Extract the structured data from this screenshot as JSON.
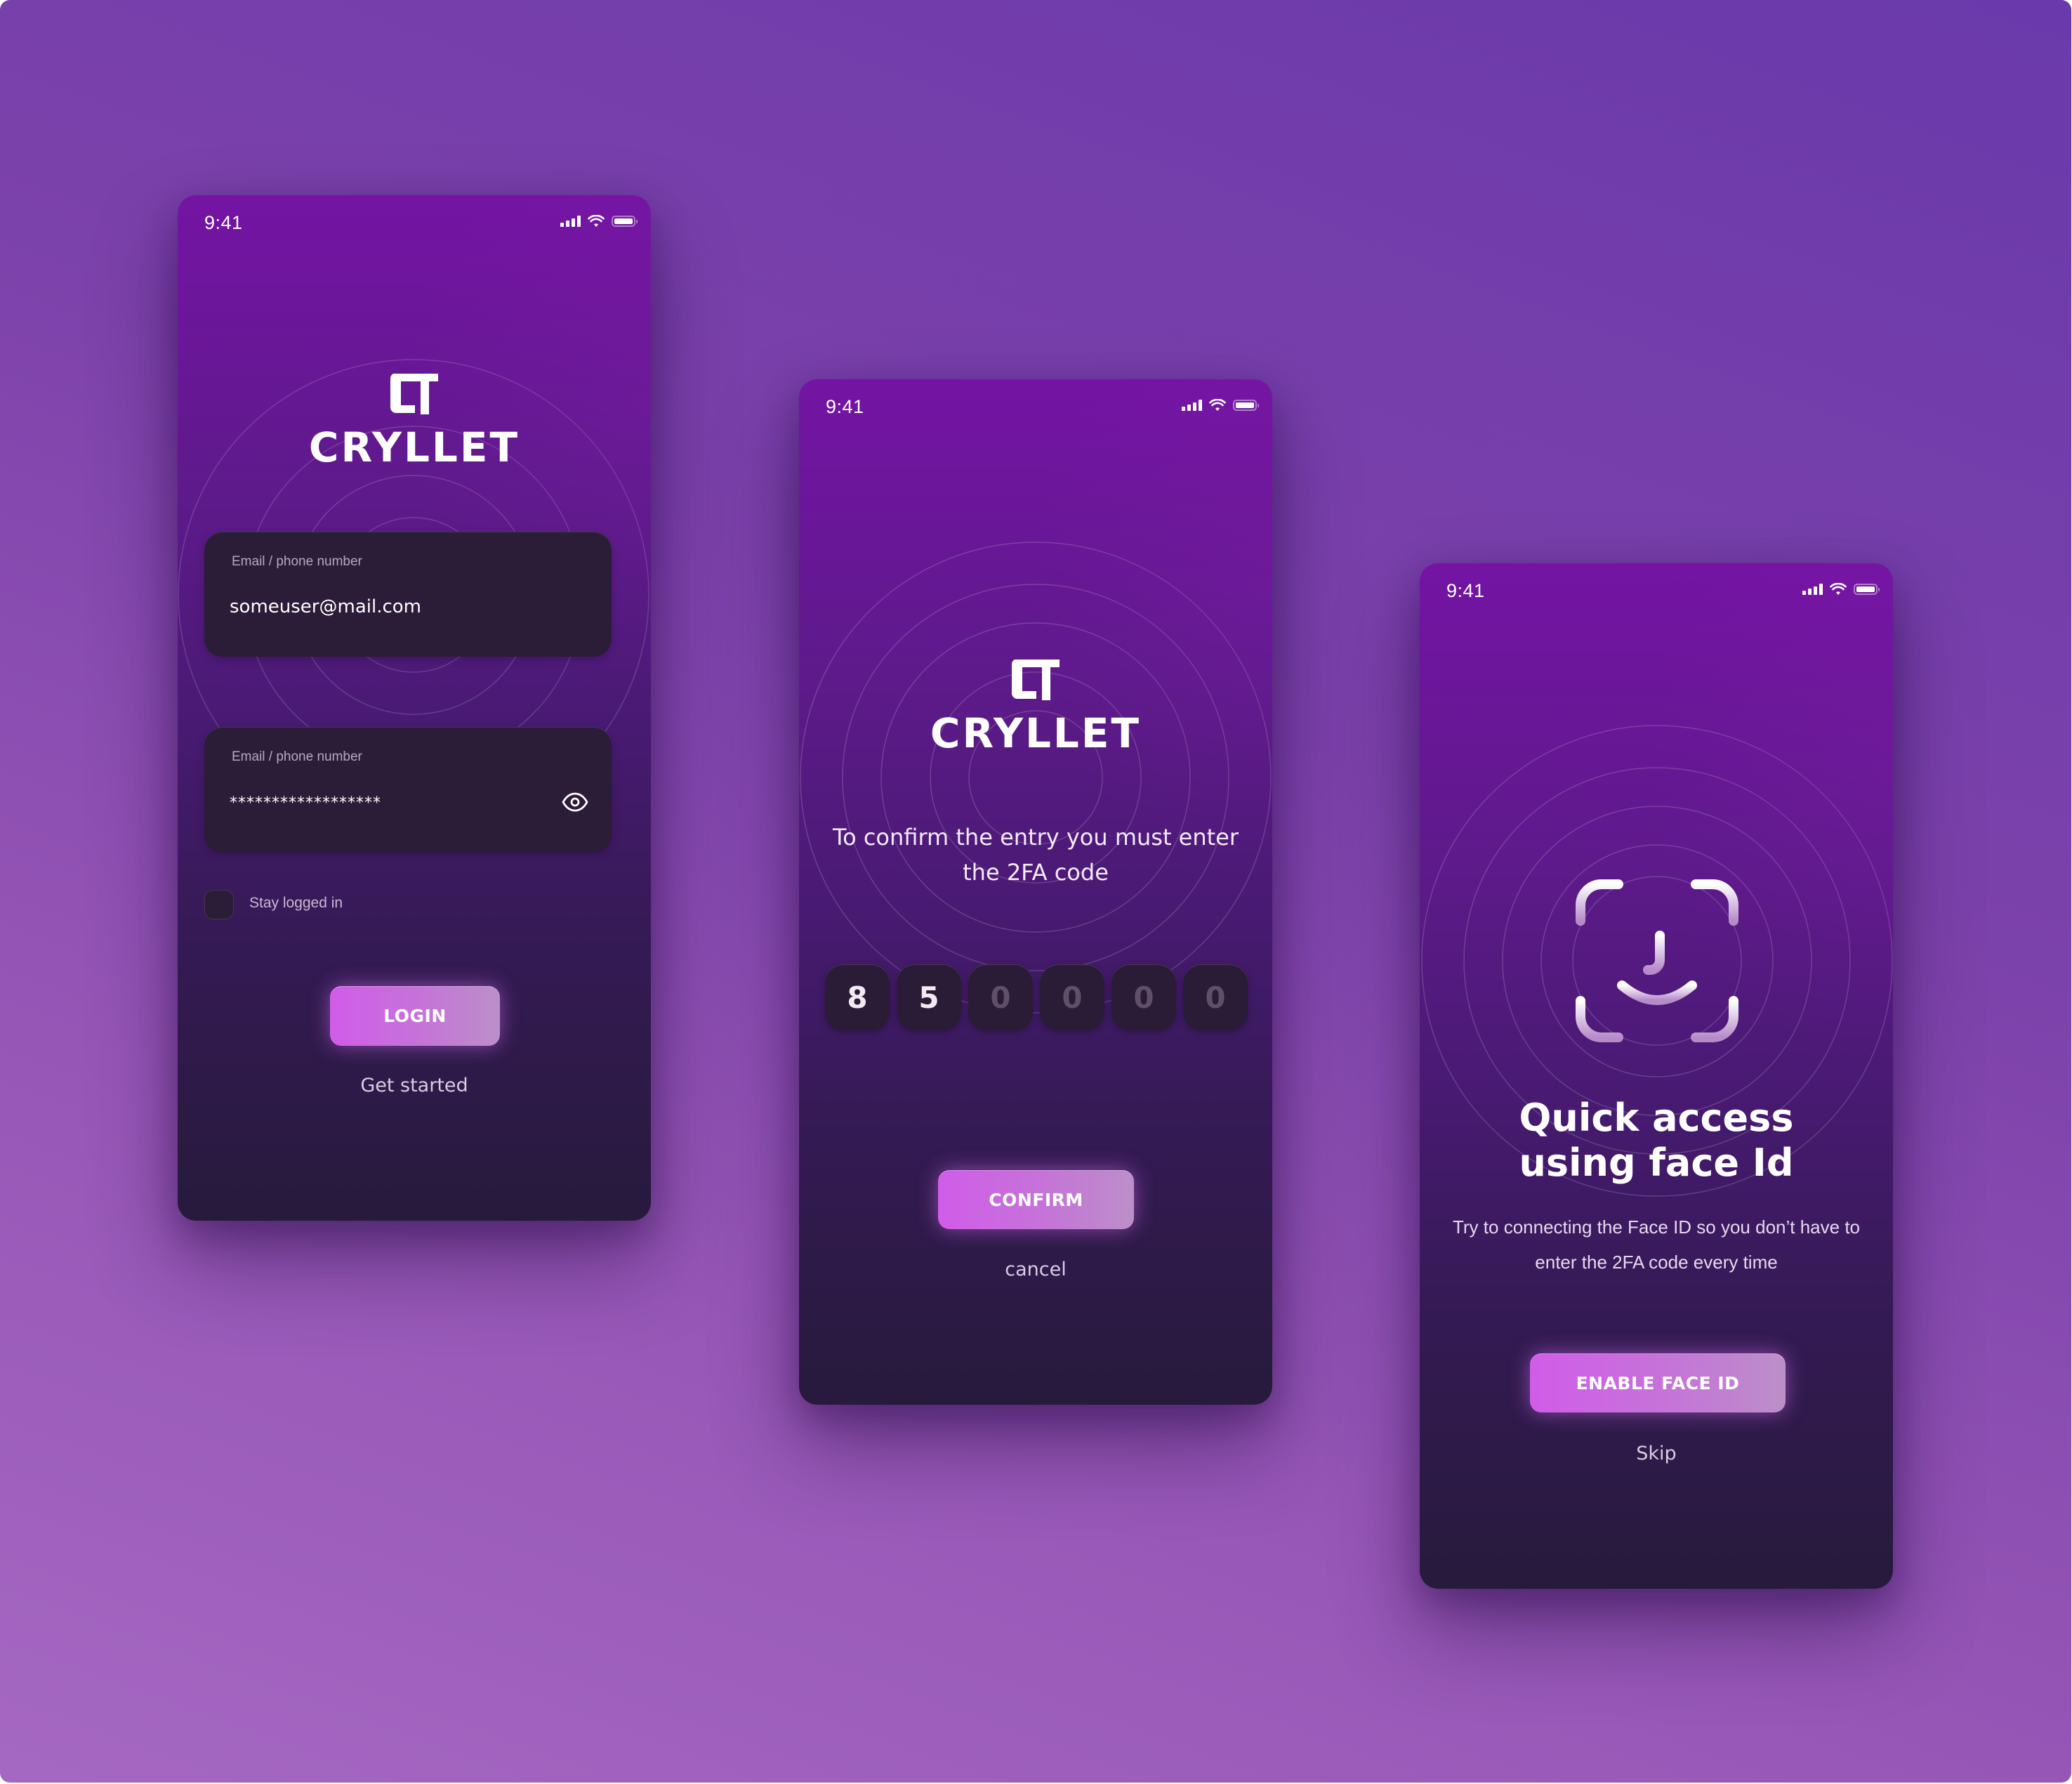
{
  "theme": {
    "accent_gradient": [
      "#d15ce9",
      "#bc8fc8"
    ],
    "field_bg": "#2b1c37",
    "phone_top": "#7414a4",
    "phone_bottom": "#271a3c"
  },
  "status_bar": {
    "time": "9:41",
    "icons": [
      "cellular-signal-icon",
      "wifi-icon",
      "battery-icon"
    ]
  },
  "brand": {
    "name": "CRYLLET",
    "mark": "CT"
  },
  "login_screen": {
    "email_field": {
      "label": "Email / phone number",
      "value": "someuser@mail.com"
    },
    "password_field": {
      "label": "Email / phone number",
      "value": "******************",
      "toggle_icon": "eye-icon"
    },
    "stay_logged_in": {
      "label": "Stay logged in",
      "checked": false
    },
    "login_button": "LOGIN",
    "get_started_link": "Get started"
  },
  "twofa_screen": {
    "message": "To confirm the entry you must enter the 2FA code",
    "code_digits": [
      {
        "value": "8",
        "filled": true
      },
      {
        "value": "5",
        "filled": true
      },
      {
        "value": "0",
        "filled": false
      },
      {
        "value": "0",
        "filled": false
      },
      {
        "value": "0",
        "filled": false
      },
      {
        "value": "0",
        "filled": false
      }
    ],
    "confirm_button": "CONFIRM",
    "cancel_link": "cancel"
  },
  "faceid_screen": {
    "icon": "face-id-icon",
    "title_line1": "Quick access",
    "title_line2": "using face Id",
    "description": "Try to connecting the Face ID so you don’t have to enter the 2FA code every time",
    "enable_button": "ENABLE FACE ID",
    "skip_link": "Skip"
  }
}
